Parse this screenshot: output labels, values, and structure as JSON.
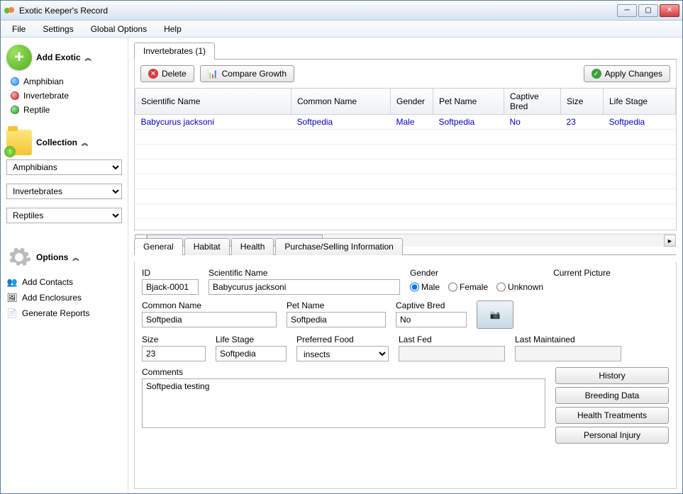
{
  "window": {
    "title": "Exotic Keeper's Record"
  },
  "menu": {
    "file": "File",
    "settings": "Settings",
    "global": "Global Options",
    "help": "Help"
  },
  "sidebar": {
    "add_exotic": {
      "title": "Add Exotic",
      "items": [
        "Amphibian",
        "Invertebrate",
        "Reptile"
      ]
    },
    "collection": {
      "title": "Collection",
      "selects": [
        "Amphibians",
        "Invertebrates",
        "Reptiles"
      ]
    },
    "options": {
      "title": "Options",
      "items": [
        "Add Contacts",
        "Add Enclosures",
        "Generate Reports"
      ]
    }
  },
  "top_tab": "Invertebrates (1)",
  "toolbar": {
    "delete": "Delete",
    "compare": "Compare Growth",
    "apply": "Apply Changes"
  },
  "table": {
    "headers": [
      "Scientific Name",
      "Common Name",
      "Gender",
      "Pet Name",
      "Captive Bred",
      "Size",
      "Life Stage"
    ],
    "rows": [
      {
        "sci": "Babycurus jacksoni",
        "common": "Softpedia",
        "gender": "Male",
        "pet": "Softpedia",
        "captive": "No",
        "size": "23",
        "stage": "Softpedia"
      }
    ]
  },
  "detail_tabs": {
    "general": "General",
    "habitat": "Habitat",
    "health": "Health",
    "purchase": "Purchase/Selling Information"
  },
  "general": {
    "labels": {
      "id": "ID",
      "sci": "Scientific Name",
      "gender": "Gender",
      "pic": "Current Picture",
      "common": "Common Name",
      "pet": "Pet Name",
      "captive": "Captive Bred",
      "size": "Size",
      "stage": "Life Stage",
      "food": "Preferred Food",
      "fed": "Last Fed",
      "maint": "Last Maintained",
      "comments": "Comments"
    },
    "values": {
      "id": "Bjack-0001",
      "sci": "Babycurus jacksoni",
      "common": "Softpedia",
      "pet": "Softpedia",
      "captive": "No",
      "size": "23",
      "stage": "Softpedia",
      "food": "insects",
      "fed": "",
      "maint": "",
      "comments": "Softpedia testing"
    },
    "gender_options": {
      "male": "Male",
      "female": "Female",
      "unknown": "Unknown"
    },
    "gender_selected": "male"
  },
  "buttons": {
    "history": "History",
    "breeding": "Breeding Data",
    "treat": "Health Treatments",
    "injury": "Personal Injury"
  }
}
